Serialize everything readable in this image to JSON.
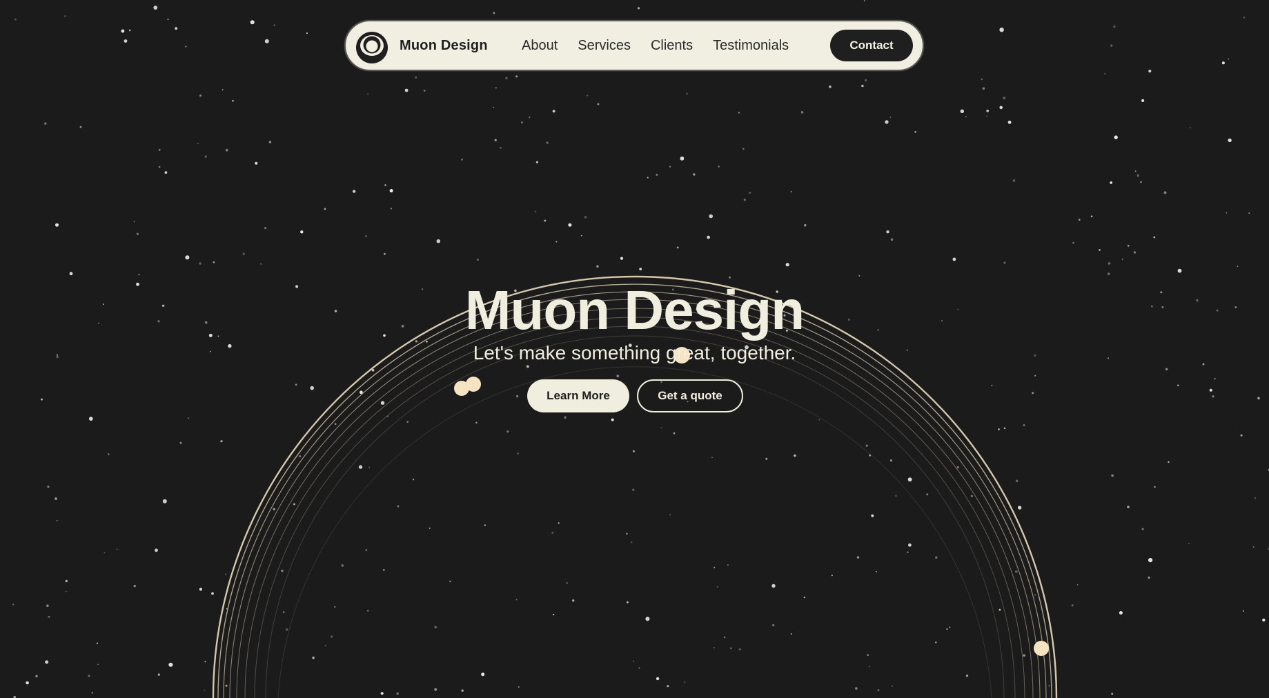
{
  "nav": {
    "brand": "Muon Design",
    "logo_icon": "muon-logo-icon",
    "links": [
      "About",
      "Services",
      "Clients",
      "Testimonials"
    ],
    "contact_label": "Contact"
  },
  "hero": {
    "title": "Muon Design",
    "subtitle": "Let's make something great, together.",
    "primary_button": "Learn More",
    "secondary_button": "Get a quote"
  },
  "colors": {
    "background": "#1b1b1b",
    "cream": "#f0eede",
    "nav_bg": "#f1efe2",
    "orbit": "#cbbfa4",
    "orbit_dot": "#f6e3c2",
    "dark_button": "#1f1f1f"
  }
}
